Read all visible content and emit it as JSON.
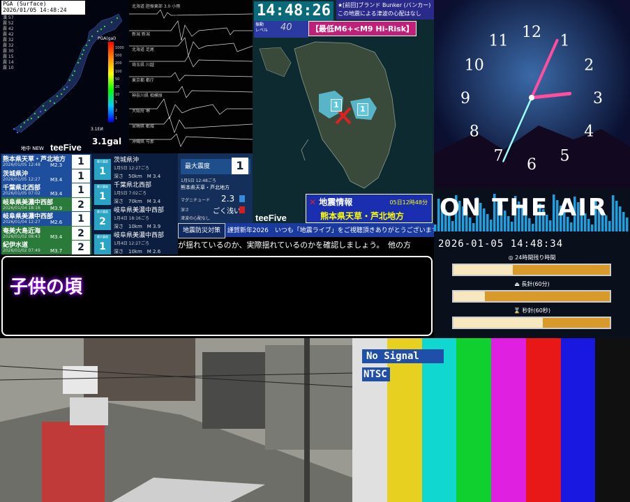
{
  "japan_map": {
    "header_line1": "PGA (Surface)",
    "header_line2": "2026/01/05 14:48:24",
    "legend": [
      "漢 57",
      "震 52",
      "震 42",
      "震 42",
      "震 32",
      "震 32",
      "震 30",
      "震 15",
      "震 14",
      "震 10"
    ],
    "scale_label": "PGA(gal)",
    "scale_ticks": [
      "1000",
      "500",
      "200",
      "100",
      "50",
      "20",
      "10",
      "5",
      "2",
      "1"
    ],
    "gal_value": "3.1gal",
    "gal_small": "3.1ЕИ",
    "new_label": "地中 NEW",
    "brand": "teeFive"
  },
  "seismograph": {
    "stations": [
      "北海道 胆振東部 3.0 小雨",
      "新潟 新潟",
      "北海道 足尾",
      "埼玉県 川越",
      "東京都 都庁",
      "神奈川県 相模原",
      "大阪府 堺",
      "宮崎県 都城",
      "沖縄県 与那"
    ]
  },
  "quake_list": [
    {
      "loc": "熊本県天草・芦北地方",
      "dt": "2026/01/05 12:48",
      "mag": "M2.3",
      "int": "1",
      "color": "#1d4f9e"
    },
    {
      "loc": "茨城県沖",
      "dt": "2026/01/05 12:27",
      "mag": "M3.4",
      "int": "1",
      "color": "#1d4f9e"
    },
    {
      "loc": "千葉県北西部",
      "dt": "2026/01/05 07:02",
      "mag": "M3.4",
      "int": "1",
      "color": "#1d4f9e"
    },
    {
      "loc": "岐阜県美濃中西部",
      "dt": "2026/01/04 18:16",
      "mag": "M3.9",
      "int": "2",
      "color": "#2a7a3a"
    },
    {
      "loc": "岐阜県美濃中西部",
      "dt": "2026/01/04 12:27",
      "mag": "M2.6",
      "int": "1",
      "color": "#1d4f9e"
    },
    {
      "loc": "奄美大島近海",
      "dt": "2026/01/02 08:43",
      "mag": "M3.4",
      "int": "2",
      "color": "#2a7a3a"
    },
    {
      "loc": "紀伊水道",
      "dt": "2026/01/02 07:49",
      "mag": "M3.7",
      "int": "2",
      "color": "#2a7a3a"
    }
  ],
  "detail_list": [
    {
      "int": "1",
      "place": "茨城県沖",
      "time": "1月5日 12:27ごろ",
      "depth": "深さ　50km",
      "mag": "M 3.4"
    },
    {
      "int": "1",
      "place": "千葉県北西部",
      "time": "1月5日 7:02ごろ",
      "depth": "深さ　70km",
      "mag": "M 3.4"
    },
    {
      "int": "2",
      "place": "岐阜県美濃中西部",
      "time": "1月4日 18:16ごろ",
      "depth": "深さ　10km",
      "mag": "M 3.9"
    },
    {
      "int": "1",
      "place": "岐阜県美濃中西部",
      "time": "1月4日 12:27ごろ",
      "depth": "深さ　10km",
      "mag": "M 2.6"
    }
  ],
  "detail_caption": "最大震度",
  "max_intensity": {
    "title": "最大震度",
    "value": "1",
    "time": "1月5日 12:48ごろ",
    "place": "熊本県天草・芦北地方",
    "mag_label": "マグニチュード",
    "mag": "2.3",
    "depth_label": "深さ",
    "depth": "ごく浅い",
    "tsunami": "津波の心配なし"
  },
  "kyushu": {
    "clock": "14:48:26",
    "bunker": "★[前回]ブランド Bunker (バンカー)",
    "bunker2": "この地震による津波の心配はなし",
    "level_label": "振動\nレベル",
    "level_value": "40",
    "risk": "【最低M6+<M9 Hi-Risk】",
    "info_title": "地震情報",
    "info_date": "05日12時48分",
    "info_place": "熊本県天草・芦北地方",
    "brand": "teeFive",
    "marker_values": [
      "1",
      "1"
    ]
  },
  "ticker": {
    "tag": "地震防災対策",
    "line1": "謹賀新年2026　いつも「地震ライブ」をご視聴頂きありがとうございます!",
    "line2": "が揺れているのか、実際揺れているのかを確認しましょう。　他の方"
  },
  "caption": {
    "text": "子供の頃"
  },
  "clock_panel": {
    "numbers": [
      "12",
      "1",
      "2",
      "3",
      "4",
      "5",
      "6",
      "7",
      "8",
      "9",
      "10",
      "11"
    ],
    "hour_deg": 84,
    "minute_deg": 24,
    "second_deg": 204
  },
  "on_air": {
    "title": "ON THE AIR",
    "datetime": "2026-01-05 14:48:34",
    "bar1_label": "◎ 24時間残り時間",
    "bar1_fill": 0.38,
    "bar2_label": "⏏ 長針(60分)",
    "bar2_fill": 0.2,
    "bar3_label": "⌛ 秒針(60秒)",
    "bar3_fill": 0.57
  },
  "color_bars": {
    "no_signal": "No Signal",
    "ntsc": "NTSC",
    "colors": [
      "#e0e0e0",
      "#e8d020",
      "#10d8d0",
      "#10d030",
      "#e020e0",
      "#e81818",
      "#1818e0",
      "#101010"
    ]
  }
}
